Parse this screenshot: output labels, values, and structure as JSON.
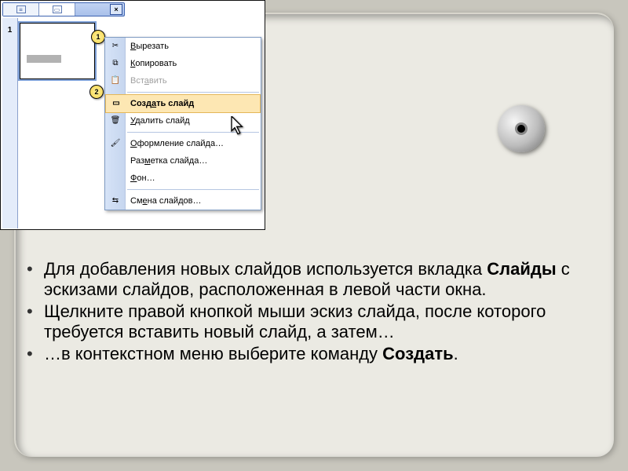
{
  "callouts": {
    "c1": "1",
    "c2": "2"
  },
  "sidebar": {
    "slide_number": "1"
  },
  "titlebar_close": "×",
  "menu": {
    "cut": {
      "label_pre": "",
      "u": "В",
      "label_post": "ырезать",
      "icon": "✂"
    },
    "copy": {
      "label_pre": "",
      "u": "К",
      "label_post": "опировать",
      "icon": "⧉"
    },
    "paste": {
      "label_pre": "Вст",
      "u": "а",
      "label_post": "вить",
      "icon": "📋"
    },
    "create_slide": {
      "label_pre": "Созд",
      "u": "а",
      "label_post": "ть слайд",
      "icon": "▭"
    },
    "delete_slide": {
      "label_pre": "",
      "u": "У",
      "label_post": "далить слайд",
      "icon": "🗑"
    },
    "slide_design": {
      "label_pre": "",
      "u": "О",
      "label_post": "формление слайда…",
      "icon": "🖌"
    },
    "slide_layout": {
      "label_pre": "Раз",
      "u": "м",
      "label_post": "етка слайда…",
      "icon": ""
    },
    "background": {
      "label_pre": "",
      "u": "Ф",
      "label_post": "он…",
      "icon": ""
    },
    "slide_transition": {
      "label_pre": "См",
      "u": "е",
      "label_post": "на слайдов…",
      "icon": "⇆"
    }
  },
  "body": {
    "b1_pre": "Для добавления новых слайдов используется вкладка ",
    "b1_bold": "Слайды",
    "b1_post": " с эскизами слайдов, расположенная в левой части окна.",
    "b2": "    Щелкните правой кнопкой мыши эскиз слайда, после которого требуется вставить новый слайд, а затем…",
    "b3_pre": "    …в контекстном меню выберите команду ",
    "b3_bold": "Создать",
    "b3_post": "."
  }
}
